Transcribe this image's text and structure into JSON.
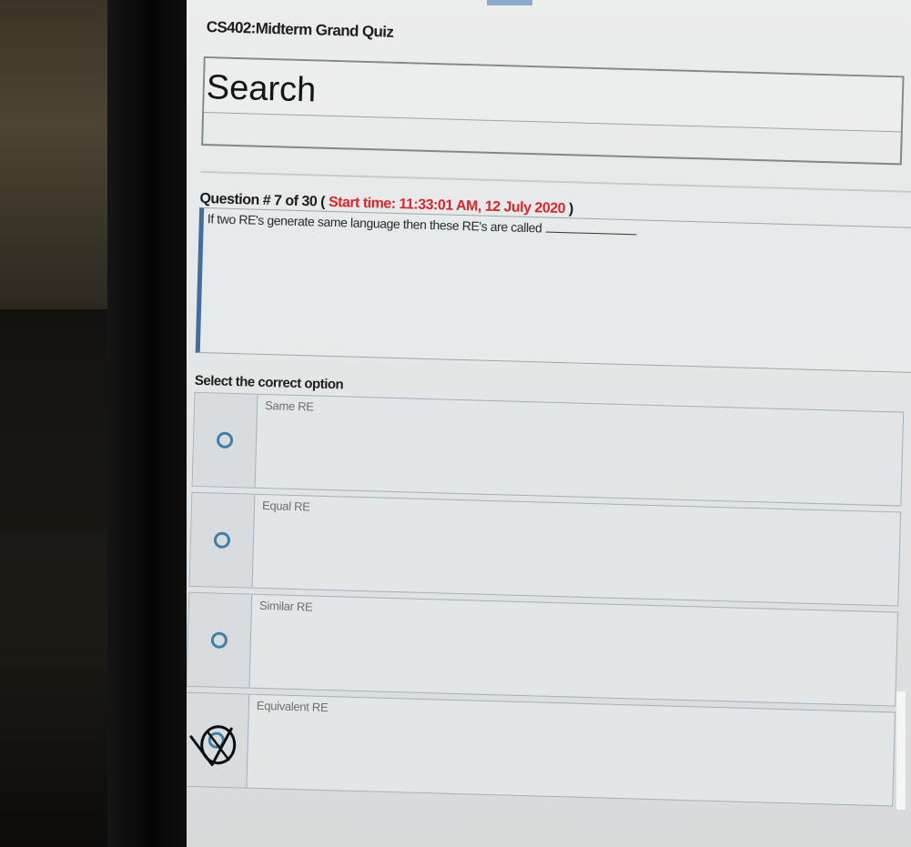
{
  "quiz": {
    "title": "CS402:Midterm Grand Quiz"
  },
  "search": {
    "placeholder": "Search"
  },
  "question": {
    "prefix": "Question # ",
    "number": "7",
    "of_text": " of ",
    "total": "30",
    "open_paren": " ( ",
    "start_label": "Start time: ",
    "start_time": "11:33:01 AM, 12 July 2020",
    "close_paren": " )",
    "text": "If two RE's generate same language then these RE's are called"
  },
  "options_section": {
    "title": "Select the correct option",
    "options": [
      {
        "label": "Same RE",
        "marked": false
      },
      {
        "label": "Equal RE",
        "marked": false
      },
      {
        "label": "Similar RE",
        "marked": false
      },
      {
        "label": "Equivalent RE",
        "marked": true
      }
    ]
  },
  "colors": {
    "start_time": "#d8262a",
    "radio": "#3f7fa8",
    "question_accent": "#3f6f9a"
  },
  "icons": {
    "radio": "radio-circle-icon",
    "pen_mark": "pen-check-circle-icon"
  }
}
